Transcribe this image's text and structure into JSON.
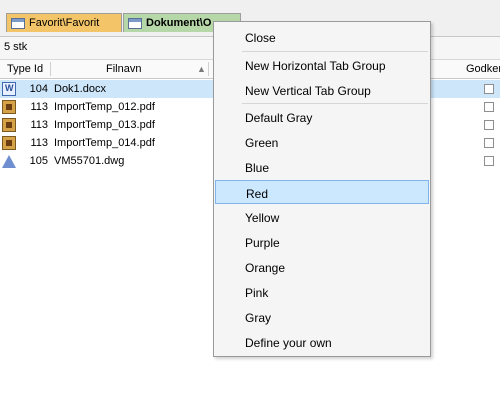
{
  "tabs": [
    {
      "label": "Favorit\\Favorit",
      "color": "#f3c468"
    },
    {
      "label": "Dokument\\O",
      "color": "#b6d7a8"
    }
  ],
  "count_label": "5 stk",
  "grid": {
    "headers": {
      "type_id": "Type Id",
      "filnavn": "Filnavn",
      "godkent": "Godken"
    },
    "rows": [
      {
        "icon": "word-document-icon",
        "id": "104",
        "name": "Dok1.docx",
        "selected": true
      },
      {
        "icon": "pdf-file-icon",
        "id": "113",
        "name": "ImportTemp_012.pdf"
      },
      {
        "icon": "pdf-file-icon",
        "id": "113",
        "name": "ImportTemp_013.pdf"
      },
      {
        "icon": "pdf-file-icon",
        "id": "113",
        "name": "ImportTemp_014.pdf"
      },
      {
        "icon": "dwg-file-icon",
        "id": "105",
        "name": "VM55701.dwg"
      }
    ]
  },
  "context_menu": {
    "items": [
      {
        "label": "Close"
      },
      {
        "label": "New Horizontal Tab Group"
      },
      {
        "label": "New Vertical Tab Group"
      },
      {
        "label": "Default Gray"
      },
      {
        "label": "Green"
      },
      {
        "label": "Blue"
      },
      {
        "label": "Red",
        "highlighted": true
      },
      {
        "label": "Yellow"
      },
      {
        "label": "Purple"
      },
      {
        "label": "Orange"
      },
      {
        "label": "Pink"
      },
      {
        "label": "Gray"
      },
      {
        "label": "Define your own"
      }
    ],
    "highlight_color": "#cce8ff"
  }
}
